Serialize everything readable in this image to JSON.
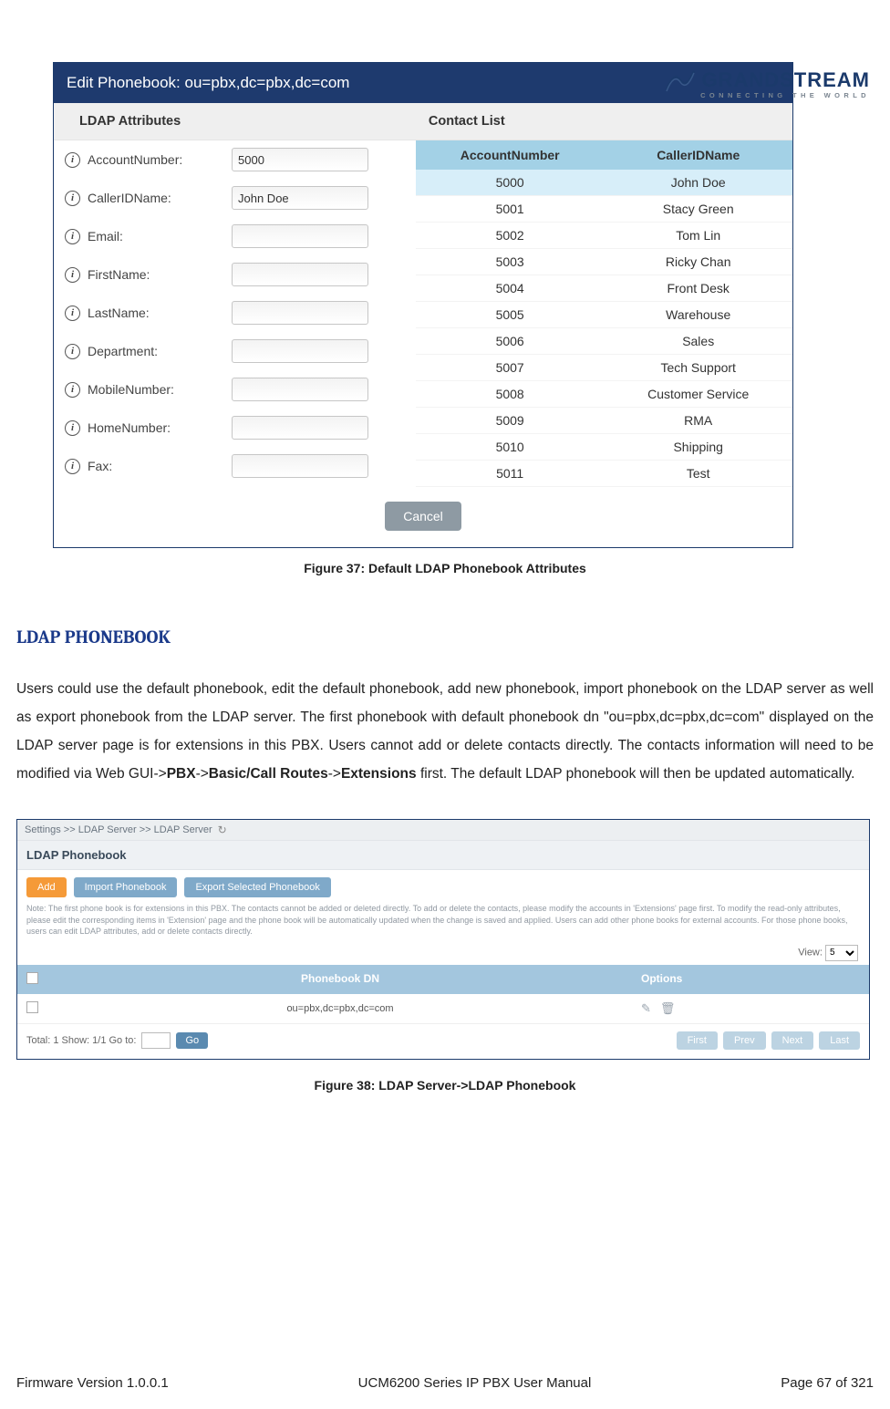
{
  "logo": {
    "main": "GRANDSTREAM",
    "sub": "CONNECTING THE WORLD"
  },
  "figure1": {
    "title": "Edit Phonebook: ou=pbx,dc=pbx,dc=com",
    "left_header": "LDAP Attributes",
    "right_header": "Contact List",
    "attributes": [
      {
        "label": "AccountNumber:",
        "value": "5000"
      },
      {
        "label": "CallerIDName:",
        "value": "John Doe"
      },
      {
        "label": "Email:",
        "value": ""
      },
      {
        "label": "FirstName:",
        "value": ""
      },
      {
        "label": "LastName:",
        "value": ""
      },
      {
        "label": "Department:",
        "value": ""
      },
      {
        "label": "MobileNumber:",
        "value": ""
      },
      {
        "label": "HomeNumber:",
        "value": ""
      },
      {
        "label": "Fax:",
        "value": ""
      }
    ],
    "contact_headers": {
      "col1": "AccountNumber",
      "col2": "CallerIDName"
    },
    "contacts": [
      {
        "num": "5000",
        "name": "John Doe",
        "selected": true
      },
      {
        "num": "5001",
        "name": "Stacy Green",
        "selected": false
      },
      {
        "num": "5002",
        "name": "Tom Lin",
        "selected": false
      },
      {
        "num": "5003",
        "name": "Ricky Chan",
        "selected": false
      },
      {
        "num": "5004",
        "name": "Front Desk",
        "selected": false
      },
      {
        "num": "5005",
        "name": "Warehouse",
        "selected": false
      },
      {
        "num": "5006",
        "name": "Sales",
        "selected": false
      },
      {
        "num": "5007",
        "name": "Tech Support",
        "selected": false
      },
      {
        "num": "5008",
        "name": "Customer Service",
        "selected": false
      },
      {
        "num": "5009",
        "name": "RMA",
        "selected": false
      },
      {
        "num": "5010",
        "name": "Shipping",
        "selected": false
      },
      {
        "num": "5011",
        "name": "Test",
        "selected": false
      }
    ],
    "cancel": "Cancel",
    "caption": "Figure 37: Default LDAP Phonebook Attributes"
  },
  "section_title": "LDAP PHONEBOOK",
  "paragraph": {
    "p1": "Users could use the default phonebook, edit the default phonebook, add new phonebook, import phonebook on the LDAP server as well as export phonebook from the LDAP server. The first phonebook with default phonebook dn \"ou=pbx,dc=pbx,dc=com\" displayed on the LDAP server page is for extensions in this PBX. Users cannot add or delete contacts directly. The contacts information will need to be modified via Web GUI->",
    "b1": "PBX",
    "s1": "->",
    "b2": "Basic/Call Routes",
    "s2": "->",
    "b3": "Extensions",
    "p2": " first. The default LDAP phonebook will then be updated automatically."
  },
  "figure2": {
    "breadcrumb": "Settings >> LDAP Server >> LDAP Server",
    "subhead": "LDAP Phonebook",
    "btn_add": "Add",
    "btn_import": "Import Phonebook",
    "btn_export": "Export Selected Phonebook",
    "note": "Note: The first phone book is for extensions in this PBX. The contacts cannot be added or deleted directly. To add or delete the contacts, please modify the accounts in 'Extensions' page first. To modify the read-only attributes, please edit the corresponding items in 'Extension' page and the phone book will be automatically updated when the change is saved and applied. Users can add other phone books for external accounts. For those phone books, users can edit LDAP attributes, add or delete contacts directly.",
    "view_label": "View:",
    "view_value": "5",
    "th_dn": "Phonebook DN",
    "th_opt": "Options",
    "row_dn": "ou=pbx,dc=pbx,dc=com",
    "footer_status": "Total: 1    Show: 1/1    Go to:",
    "go_btn": "Go",
    "pager": {
      "first": "First",
      "prev": "Prev",
      "next": "Next",
      "last": "Last"
    },
    "caption": "Figure 38: LDAP Server->LDAP Phonebook"
  },
  "footer": {
    "left": "Firmware Version 1.0.0.1",
    "center": "UCM6200 Series IP PBX User Manual",
    "right": "Page 67 of 321"
  }
}
